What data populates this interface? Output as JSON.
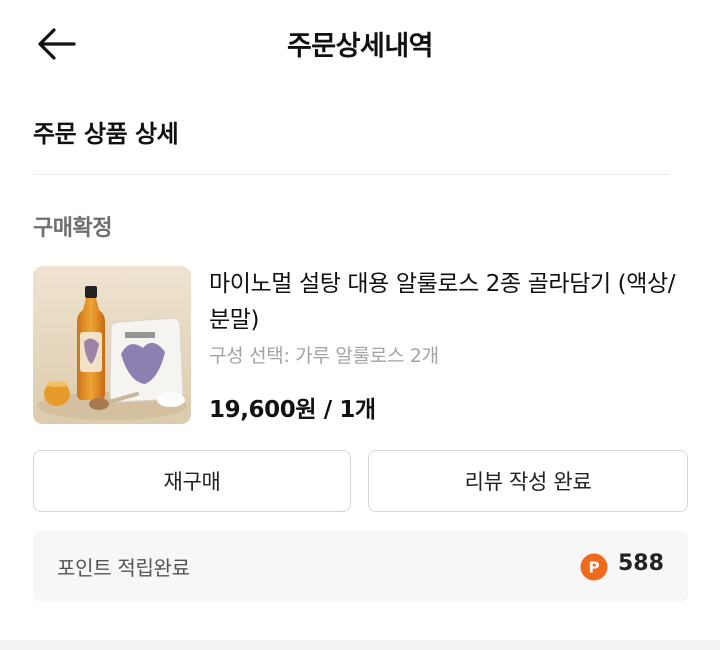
{
  "header": {
    "title": "주문상세내역",
    "back_icon": "arrow-left-icon"
  },
  "section": {
    "title": "주문 상품 상세"
  },
  "order": {
    "status": "구매확정",
    "product": {
      "name": "마이노멀 설탕 대용 알룰로스 2종 골라담기 (액상/분말)",
      "option": "구성 선택: 가루 알룰로스 2개",
      "price": "19,600원 / 1개",
      "image_label": "allulose-product-photo"
    },
    "buttons": {
      "rebuy": "재구매",
      "review": "리뷰 작성 완료"
    },
    "points": {
      "label": "포인트 적립완료",
      "value": "588",
      "icon": "point-p-icon",
      "icon_letter": "P",
      "icon_color": "#f06a1e"
    }
  },
  "colors": {
    "status_text": "#6f6f6f",
    "option_text": "#a3a3a3",
    "button_border": "#d6d6d6",
    "points_bg": "#f7f7f7"
  }
}
